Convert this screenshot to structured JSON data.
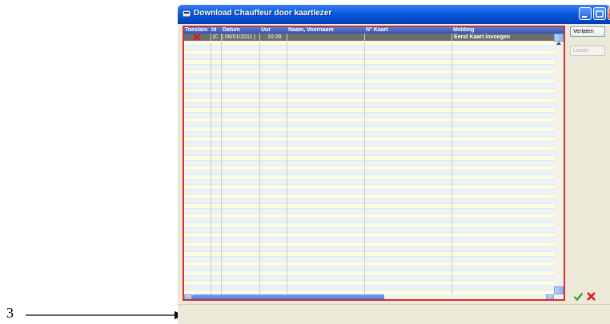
{
  "annotation": {
    "number_label": "3"
  },
  "window": {
    "title": "Download Chauffeur door kaartlezer",
    "controls": [
      "minimize",
      "maximize",
      "close"
    ]
  },
  "grid": {
    "columns": [
      "Toestand",
      "Id",
      "Datum",
      "Uur",
      "Naam, Voornaam",
      "N° Kaart",
      "Melding"
    ],
    "rows": [
      {
        "toestand_icon": "red-x-icon",
        "id": "|C",
        "datum": "| 06/01/2011 |",
        "uur": "10:28",
        "naam": "",
        "kaart": "",
        "melding": "Eerst Kaart invoegen"
      }
    ]
  },
  "side_panel": {
    "verlaten_label": "Verlaten",
    "lezen_label": "Lezen"
  },
  "icons": {
    "ok": "green-check-icon",
    "cancel": "red-x-icon"
  },
  "colors": {
    "title_bar": "#0a5bdc",
    "frame_border": "#d23030",
    "selected_row": "#6d6d6d",
    "header": "#3e64c4"
  }
}
